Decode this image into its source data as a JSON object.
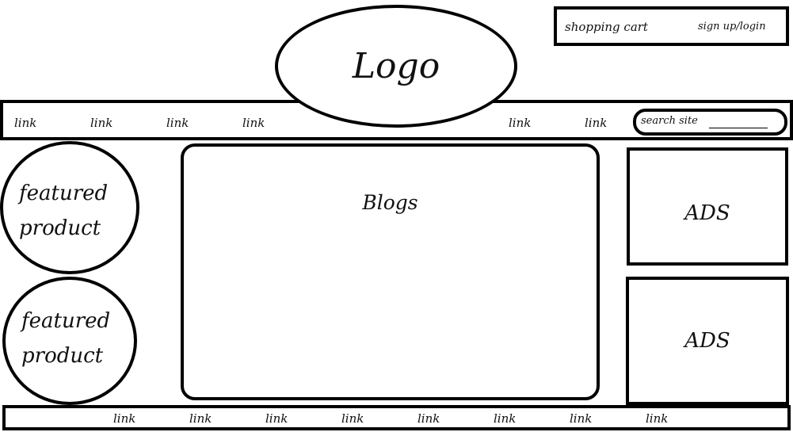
{
  "header": {
    "logo_text": "Logo",
    "cart_label": "shopping cart",
    "login_label": "sign up/login"
  },
  "nav": {
    "links": [
      "link",
      "link",
      "link",
      "link",
      "link",
      "link"
    ],
    "search_placeholder": "search site"
  },
  "sidebar": {
    "featured": [
      {
        "line1": "featured",
        "line2": "product"
      },
      {
        "line1": "featured",
        "line2": "product"
      }
    ]
  },
  "main": {
    "title": "Blogs"
  },
  "ads": {
    "labels": [
      "ADS",
      "ADS"
    ]
  },
  "footer": {
    "links": [
      "link",
      "link",
      "link",
      "link",
      "link",
      "link",
      "link",
      "link"
    ]
  }
}
